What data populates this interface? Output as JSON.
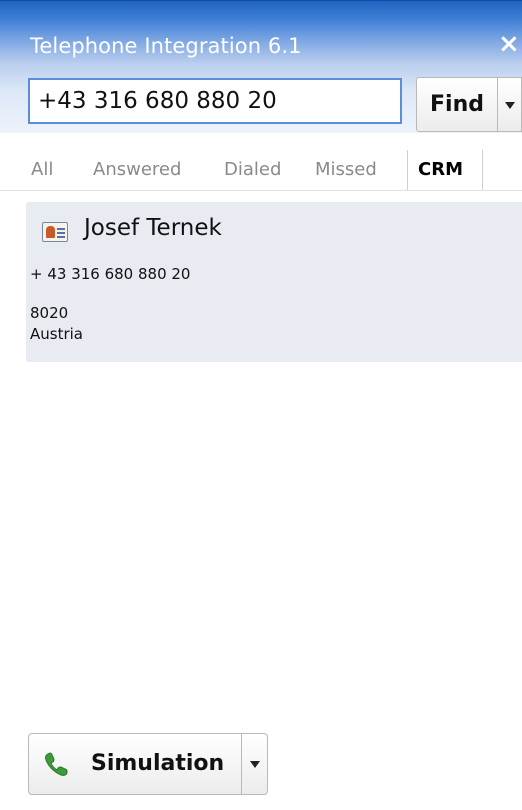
{
  "window": {
    "title": "Telephone Integration 6.1",
    "close_glyph": "×"
  },
  "search": {
    "value": "+43 316 680 880 20",
    "find_label": "Find"
  },
  "tabs": [
    {
      "label": "All",
      "active": false
    },
    {
      "label": "Answered",
      "active": false
    },
    {
      "label": "Dialed",
      "active": false
    },
    {
      "label": "Missed",
      "active": false
    },
    {
      "label": "CRM",
      "active": true
    }
  ],
  "result": {
    "icon": "contact-card-icon",
    "name": "Josef Ternek",
    "phone": "+ 43 316 680 880 20",
    "zip": "8020",
    "country": "Austria"
  },
  "footer": {
    "simulation_label": "Simulation",
    "simulation_icon": "phone-icon"
  },
  "colors": {
    "title_blue": "#1f63bf",
    "input_border": "#5a8fd8",
    "card_bg": "#e8ebf2",
    "phone_green": "#3f9a3a"
  }
}
